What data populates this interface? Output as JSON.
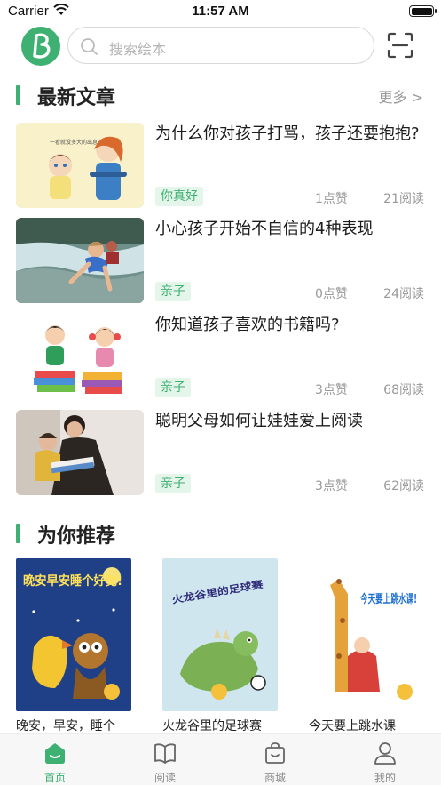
{
  "status": {
    "carrier": "Carrier",
    "time": "11:57 AM"
  },
  "search": {
    "placeholder": "搜索绘本"
  },
  "articles_section": {
    "title": "最新文章",
    "more": "更多 >"
  },
  "articles": [
    {
      "title": "为什么你对孩子打骂，孩子还要抱抱?",
      "tag": "你真好",
      "likes": "1点赞",
      "reads": "21阅读",
      "thumb_caption": "一看就没多大的出息"
    },
    {
      "title": "小心孩子开始不自信的4种表现",
      "tag": "亲子",
      "likes": "0点赞",
      "reads": "24阅读"
    },
    {
      "title": "你知道孩子喜欢的书籍吗?",
      "tag": "亲子",
      "likes": "3点赞",
      "reads": "68阅读"
    },
    {
      "title": "聪明父母如何让娃娃爱上阅读",
      "tag": "亲子",
      "likes": "3点赞",
      "reads": "62阅读"
    }
  ],
  "recommend_section": {
    "title": "为你推荐"
  },
  "books": [
    {
      "title": "晚安，早安，睡个",
      "cover_text": "晚安早安睡个好觉!"
    },
    {
      "title": "火龙谷里的足球赛",
      "cover_text": "火龙谷里的足球赛"
    },
    {
      "title": "今天要上跳水课",
      "cover_text": "今天要上跳水课!"
    }
  ],
  "tabs": [
    {
      "label": "首页",
      "icon": "home-icon",
      "active": true
    },
    {
      "label": "阅读",
      "icon": "book-icon",
      "active": false
    },
    {
      "label": "商城",
      "icon": "shopping-bag-icon",
      "active": false
    },
    {
      "label": "我的",
      "icon": "user-icon",
      "active": false
    }
  ],
  "colors": {
    "accent": "#3eb072",
    "tag_bg": "#e4f5ea",
    "muted": "#999999"
  }
}
